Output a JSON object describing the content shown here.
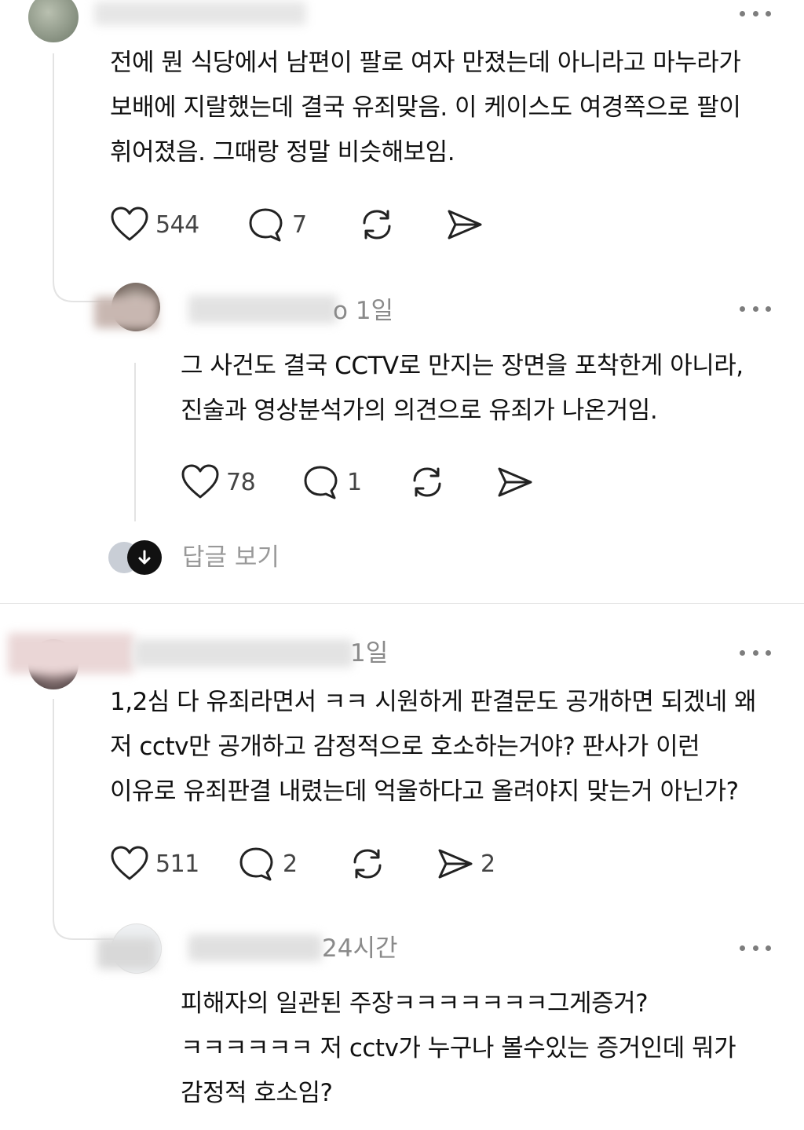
{
  "comments": [
    {
      "text_lines": [
        "전에 뭔 식당에서 남편이 팔로 여자 만졌는데 아니라고 마누라가",
        "보배에 지랄했는데 결국 유죄맞음. 이 케이스도 여경쪽으로 팔이",
        "휘어졌음. 그때랑 정말 비슷해보임."
      ],
      "likes": "544",
      "replies": "7",
      "shares": ""
    },
    {
      "time": "o 1일",
      "text_lines": [
        "그 사건도 결국 CCTV로 만지는 장면을 포착한게 아니라,",
        "진술과 영상분석가의 의견으로 유죄가 나온거임."
      ],
      "likes": "78",
      "replies": "1",
      "shares": ""
    },
    {
      "time": "1일",
      "text_lines": [
        "1,2심 다 유죄라면서 ㅋㅋ 시원하게 판결문도 공개하면 되겠네 왜",
        "저 cctv만 공개하고 감정적으로 호소하는거야? 판사가 이런",
        "이유로 유죄판결 내렸는데 억울하다고 올려야지 맞는거 아닌가?"
      ],
      "likes": "511",
      "replies": "2",
      "shares": "2"
    },
    {
      "time": "24시간",
      "text_lines": [
        "피해자의 일관된 주장ㅋㅋㅋㅋㅋㅋㅋ그게증거?",
        "ㅋㅋㅋㅋㅋㅋ 저 cctv가 누구나 볼수있는 증거인데 뭐가",
        "감정적 호소임?"
      ]
    }
  ],
  "view_replies_label": "답글 보기",
  "icons": {
    "like": "heart-icon",
    "reply": "comment-bubble-icon",
    "repost": "repost-icon",
    "share": "send-icon",
    "more": "more-dots-icon",
    "arrow": "arrow-down-icon"
  }
}
